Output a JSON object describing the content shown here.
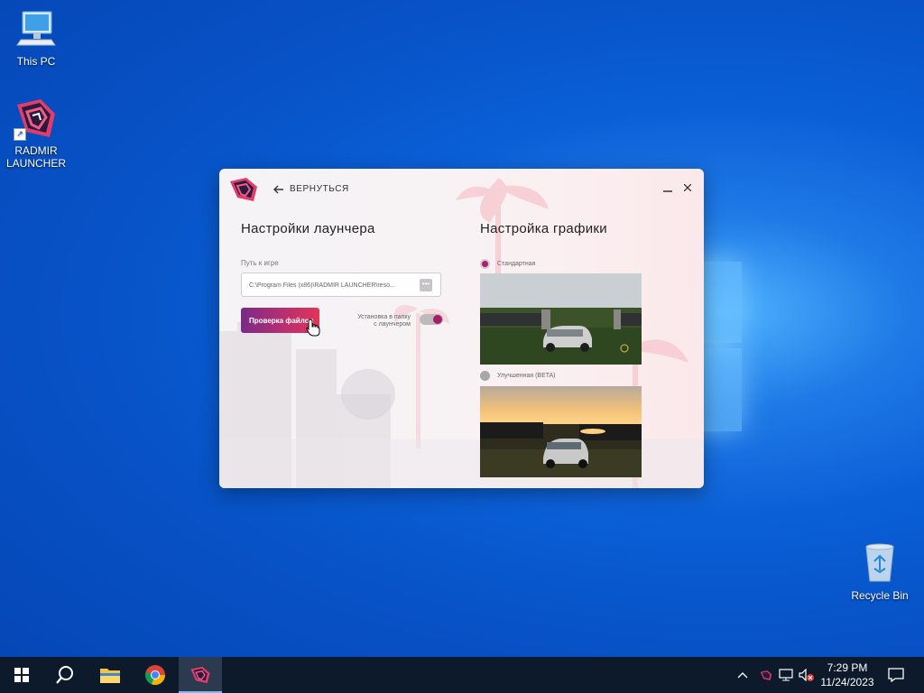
{
  "desktop": {
    "icons": [
      {
        "label": "This PC"
      },
      {
        "label": "RADMIR LAUNCHER"
      },
      {
        "label": "Recycle Bin"
      }
    ]
  },
  "launcher": {
    "back_label": "ВЕРНУТЬСЯ",
    "launcher_settings_title": "Настройки лаунчера",
    "graphics_settings_title": "Настройка графики",
    "game_path_label": "Путь к игре",
    "game_path_value": "C:\\Program Files (x86)\\RADMIR LAUNCHER\\reso...",
    "check_files_label": "Проверка файлов",
    "install_in_folder_label_line1": "Установка в папку",
    "install_in_folder_label_line2": "с лаунчером",
    "install_in_folder_enabled": true,
    "graphics_options": [
      {
        "label": "Стандартная",
        "selected": true
      },
      {
        "label": "Улучшенная (BETA)",
        "selected": false
      }
    ],
    "accent_color": "#a3246d"
  },
  "taskbar": {
    "time": "7:29 PM",
    "date": "11/24/2023"
  }
}
